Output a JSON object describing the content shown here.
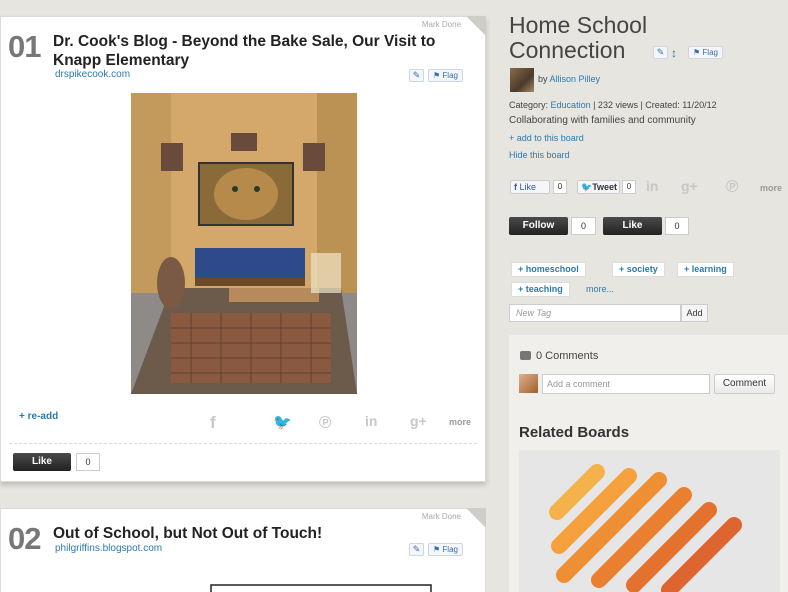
{
  "pins": [
    {
      "number": "01",
      "mark_done": "Mark Done",
      "title": "Dr. Cook's Blog - Beyond the Bake Sale, Our Visit to Knapp Elementary",
      "source": "drspikecook.com",
      "flag": "Flag",
      "readd": "+ re-add",
      "more": "more",
      "like_label": "Like",
      "like_count": "0"
    },
    {
      "number": "02",
      "mark_done": "Mark Done",
      "title": "Out of School, but Not Out of Touch!",
      "source": "philgriffins.blogspot.com",
      "flag": "Flag"
    }
  ],
  "board": {
    "title": "Home School Connection",
    "flag": "Flag",
    "owner_prefix": "by",
    "owner": "Allison Pilley",
    "category_label": "Category:",
    "category": "Education",
    "views": "| 232 views | Created: 11/20/12",
    "description": "Collaborating with families and community",
    "add_link": "+ add to this board",
    "hide_link": "Hide this board",
    "fb_like": "Like",
    "fb_count": "0",
    "tweet": "Tweet",
    "tweet_count": "0",
    "share_more": "more",
    "follow_label": "Follow",
    "follow_count": "0",
    "like_label": "Like",
    "like_count": "0",
    "tags": [
      "+ homeschool",
      "+ society",
      "+ learning",
      "+ teaching"
    ],
    "tags_more": "more...",
    "new_tag_placeholder": "New Tag",
    "add_tag_label": "Add"
  },
  "comments": {
    "count_text": "0 Comments",
    "placeholder": "Add a comment",
    "button": "Comment"
  },
  "related": {
    "heading": "Related Boards"
  },
  "colors": {
    "link": "#2a7ab0",
    "dark_button": "#2a2a2a",
    "background": "#e7e5e0"
  }
}
